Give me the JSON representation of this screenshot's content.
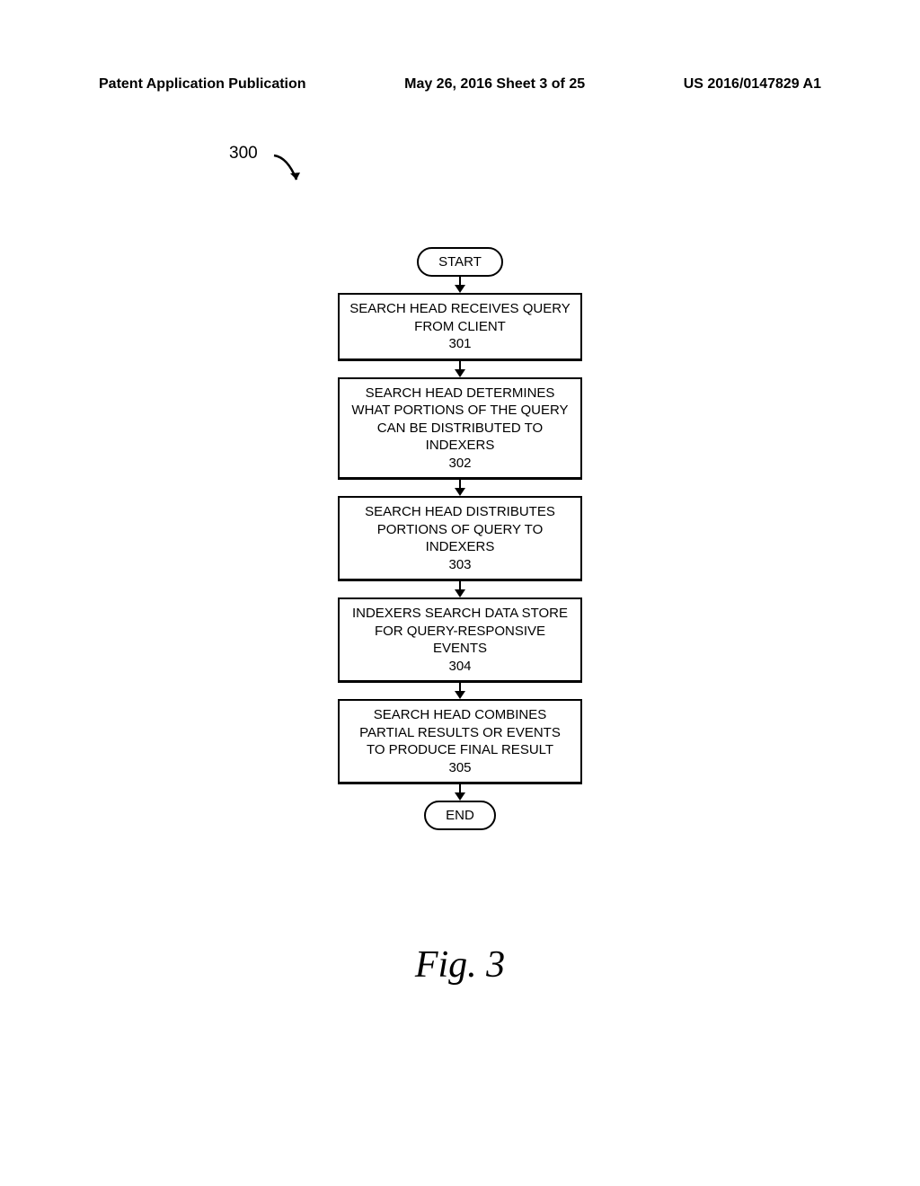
{
  "header": {
    "left": "Patent Application Publication",
    "center": "May 26, 2016  Sheet 3 of 25",
    "right": "US 2016/0147829 A1"
  },
  "reference_number": "300",
  "flowchart": {
    "start": "START",
    "end": "END",
    "steps": [
      {
        "text": "SEARCH HEAD RECEIVES QUERY FROM CLIENT",
        "number": "301"
      },
      {
        "text": "SEARCH HEAD DETERMINES WHAT PORTIONS OF THE QUERY CAN BE DISTRIBUTED TO INDEXERS",
        "number": "302"
      },
      {
        "text": "SEARCH HEAD DISTRIBUTES PORTIONS OF QUERY TO INDEXERS",
        "number": "303"
      },
      {
        "text": "INDEXERS SEARCH DATA STORE FOR QUERY-RESPONSIVE EVENTS",
        "number": "304"
      },
      {
        "text": "SEARCH HEAD COMBINES PARTIAL RESULTS OR EVENTS TO PRODUCE FINAL RESULT",
        "number": "305"
      }
    ]
  },
  "figure_label": "Fig. 3"
}
